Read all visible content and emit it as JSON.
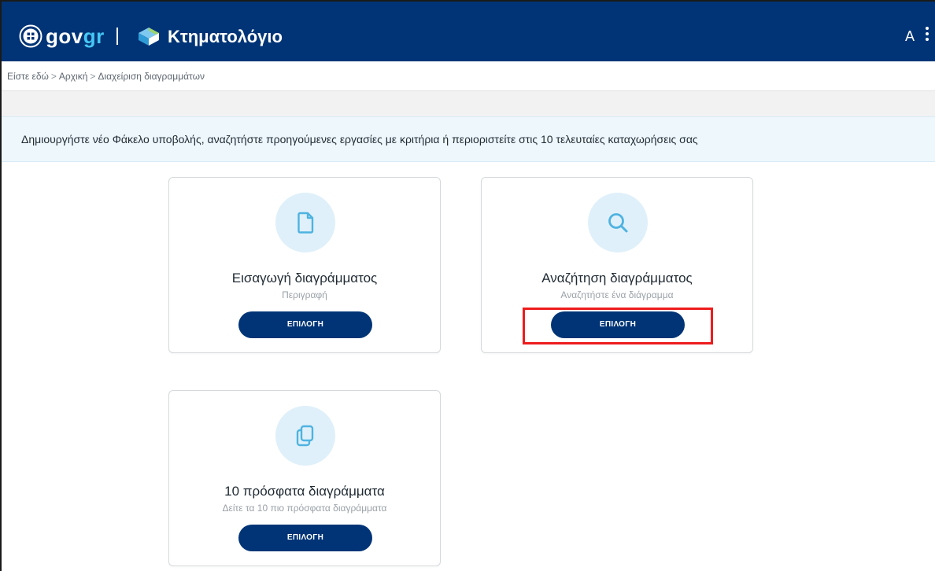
{
  "header": {
    "logo_gov": "gov",
    "logo_gr": "gr",
    "app_title": "Κτηματολόγιο",
    "user_initial": "A",
    "brand_color": "#003476",
    "gr_color": "#46c7f5"
  },
  "breadcrumb": {
    "prefix": "Είστε εδώ",
    "items": [
      "Αρχική",
      "Διαχείριση διαγραμμάτων"
    ],
    "separator": ">"
  },
  "info_banner": {
    "text": "Δημιουργήστε νέο Φάκελο υποβολής, αναζητήστε προηγούμενες εργασίες με κριτήρια ή περιοριστείτε στις 10 τελευταίες καταχωρήσεις σας"
  },
  "cards": [
    {
      "icon": "document-icon",
      "title": "Εισαγωγή διαγράμματος",
      "description": "Περιγραφή",
      "button_label": "ΕΠΙΛΟΓΗ"
    },
    {
      "icon": "search-icon",
      "title": "Αναζήτηση διαγράμματος",
      "description": "Αναζητήστε ένα διάγραμμα",
      "button_label": "ΕΠΙΛΟΓΗ",
      "highlighted": true
    },
    {
      "icon": "copy-icon",
      "title": "10 πρόσφατα διαγράμματα",
      "description": "Δείτε τα 10 πιο πρόσφατα διαγράμματα",
      "button_label": "ΕΠΙΛΟΓΗ"
    }
  ],
  "colors": {
    "highlight": "#ee1c1c",
    "icon_circle": "#dff0fa",
    "icon_stroke": "#4fb3e0",
    "banner_bg": "#eef7fc"
  }
}
